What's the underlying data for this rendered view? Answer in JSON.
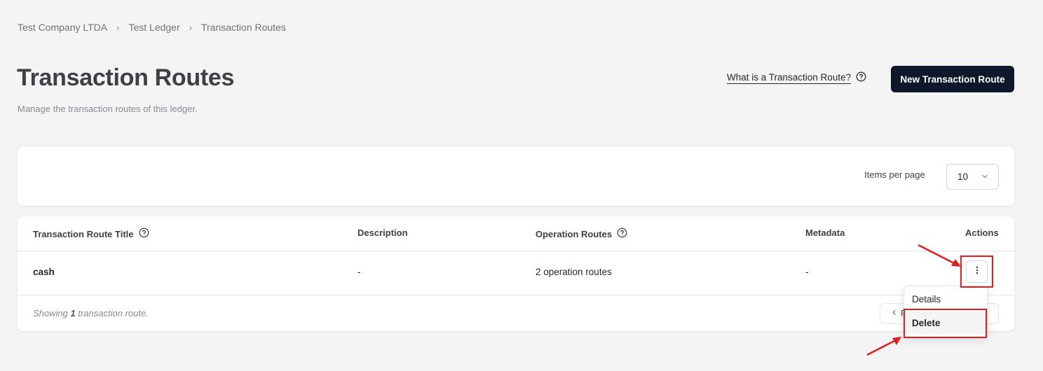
{
  "breadcrumb": {
    "items": [
      "Test Company LTDA",
      "Test Ledger",
      "Transaction Routes"
    ],
    "separator": ">"
  },
  "page": {
    "title": "Transaction Routes",
    "subtitle": "Manage the transaction routes of this ledger."
  },
  "header_actions": {
    "help_link": "What is a Transaction Route?",
    "primary_button": "New Transaction Route"
  },
  "filters": {
    "items_per_page_label": "Items per page",
    "items_per_page_value": "10"
  },
  "table": {
    "columns": [
      "Transaction Route Title",
      "Description",
      "Operation Routes",
      "Metadata",
      "Actions"
    ],
    "rows": [
      {
        "title": "cash",
        "description": "-",
        "operation_routes": "2 operation routes",
        "metadata": "-"
      }
    ],
    "footer": {
      "prefix": "Showing",
      "count": "1",
      "suffix": "transaction route."
    },
    "pager_prev_partial": "P"
  },
  "row_menu": {
    "items": [
      "Details",
      "Delete"
    ]
  },
  "colors": {
    "primary": "#0f172a",
    "background": "#f4f4f5",
    "annotation_red": "#e11d1d"
  },
  "icons": [
    "chevron-right-icon",
    "help-circle-icon",
    "chevron-down-icon",
    "more-vertical-icon",
    "chevron-left-icon",
    "red-arrow-annotation"
  ]
}
